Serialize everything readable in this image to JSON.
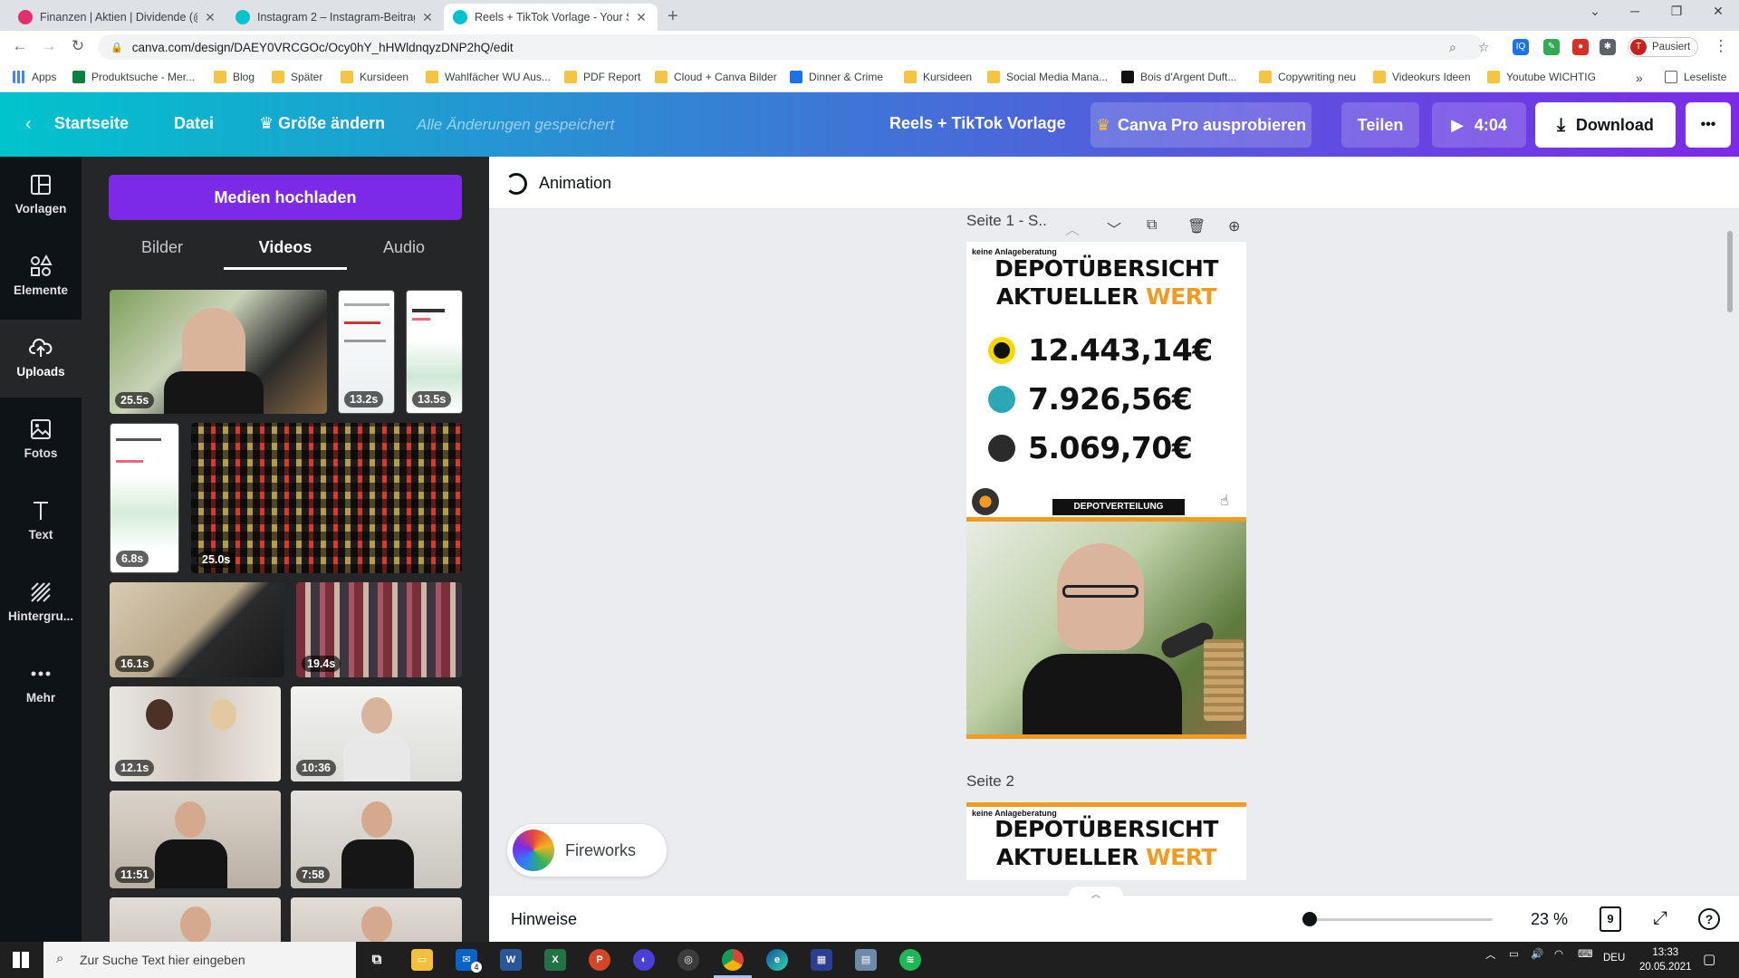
{
  "browser": {
    "tabs": [
      {
        "title": "Finanzen | Aktien | Dividende (@",
        "favicon_color": "#e1306c"
      },
      {
        "title": "Instagram 2 – Instagram-Beitrag",
        "favicon_color": "#00c4cc"
      },
      {
        "title": "Reels + TikTok Vorlage - Your St",
        "favicon_color": "#00c4cc"
      }
    ],
    "new_tab": "+",
    "url": "canva.com/design/DAEY0VRCGOc/Ocy0hY_hHWldnqyzDNP2hQ/edit",
    "profile_initial": "T",
    "profile_status": "Pausiert"
  },
  "bookmarks": {
    "items": [
      "Apps",
      "Produktsuche - Mer...",
      "Blog",
      "Später",
      "Kursideen",
      "Wahlfächer WU Aus...",
      "PDF Report",
      "Cloud + Canva Bilder",
      "Dinner & Crime",
      "Kursideen",
      "Social Media Mana...",
      "Bois d'Argent Duft...",
      "Copywriting neu",
      "Videokurs Ideen",
      "Youtube WICHTIG"
    ],
    "overflow": "»",
    "reading_list": "Leseliste"
  },
  "header": {
    "home": "Startseite",
    "file": "Datei",
    "resize": "Größe ändern",
    "saved_status": "Alle Änderungen gespeichert",
    "design_title": "Reels + TikTok Vorlage",
    "pro_button": "Canva Pro ausprobieren",
    "share_button": "Teilen",
    "play_duration": "4:04",
    "download_button": "Download",
    "more": "•••"
  },
  "rail": {
    "items": [
      {
        "label": "Vorlagen",
        "icon": "templates-icon"
      },
      {
        "label": "Elemente",
        "icon": "elements-icon"
      },
      {
        "label": "Uploads",
        "icon": "upload-cloud-icon"
      },
      {
        "label": "Fotos",
        "icon": "photos-icon"
      },
      {
        "label": "Text",
        "icon": "text-icon"
      },
      {
        "label": "Hintergru...",
        "icon": "background-icon"
      },
      {
        "label": "Mehr",
        "icon": "more-icon"
      }
    ],
    "active": "Uploads"
  },
  "panel": {
    "upload_button": "Medien hochladen",
    "tabs": [
      "Bilder",
      "Videos",
      "Audio"
    ],
    "active_tab": "Videos",
    "media": [
      {
        "duration": "25.5s"
      },
      {
        "duration": "13.2s"
      },
      {
        "duration": "13.5s"
      },
      {
        "duration": "6.8s"
      },
      {
        "duration": "25.0s"
      },
      {
        "duration": "16.1s"
      },
      {
        "duration": "19.4s"
      },
      {
        "duration": "12.1s"
      },
      {
        "duration": "10:36"
      },
      {
        "duration": "11:51"
      },
      {
        "duration": "7:58"
      }
    ]
  },
  "toolbar": {
    "animation": "Animation"
  },
  "pages": [
    {
      "label": "Seite 1 - S..",
      "note": "keine Anlageberatung",
      "title_line1": "DEPOTÜBERSICHT",
      "title_line2_a": "AKTUELLER ",
      "title_line2_b": "WERT",
      "values": [
        "12.443,14€",
        "7.926,56€",
        "5.069,70€"
      ],
      "badge": "DEPOTVERTEILUNG"
    },
    {
      "label": "Seite 2",
      "note": "keine Anlageberatung",
      "title_line1": "DEPOTÜBERSICHT",
      "title_line2_a": "AKTUELLER ",
      "title_line2_b": "WERT"
    }
  ],
  "fireworks": {
    "label": "Fireworks"
  },
  "bottom": {
    "hints": "Hinweise",
    "zoom": "23 %",
    "zoom_level": 0.23,
    "page_count": "9",
    "help": "?"
  },
  "taskbar": {
    "search_placeholder": "Zur Suche Text hier eingeben",
    "language": "DEU",
    "time": "13:33",
    "date": "20.05.2021",
    "mail_badge": "4"
  },
  "colors": {
    "accent_purple": "#7d2ae8",
    "accent_orange": "#f29b1f",
    "canva_teal": "#00c4cc"
  }
}
